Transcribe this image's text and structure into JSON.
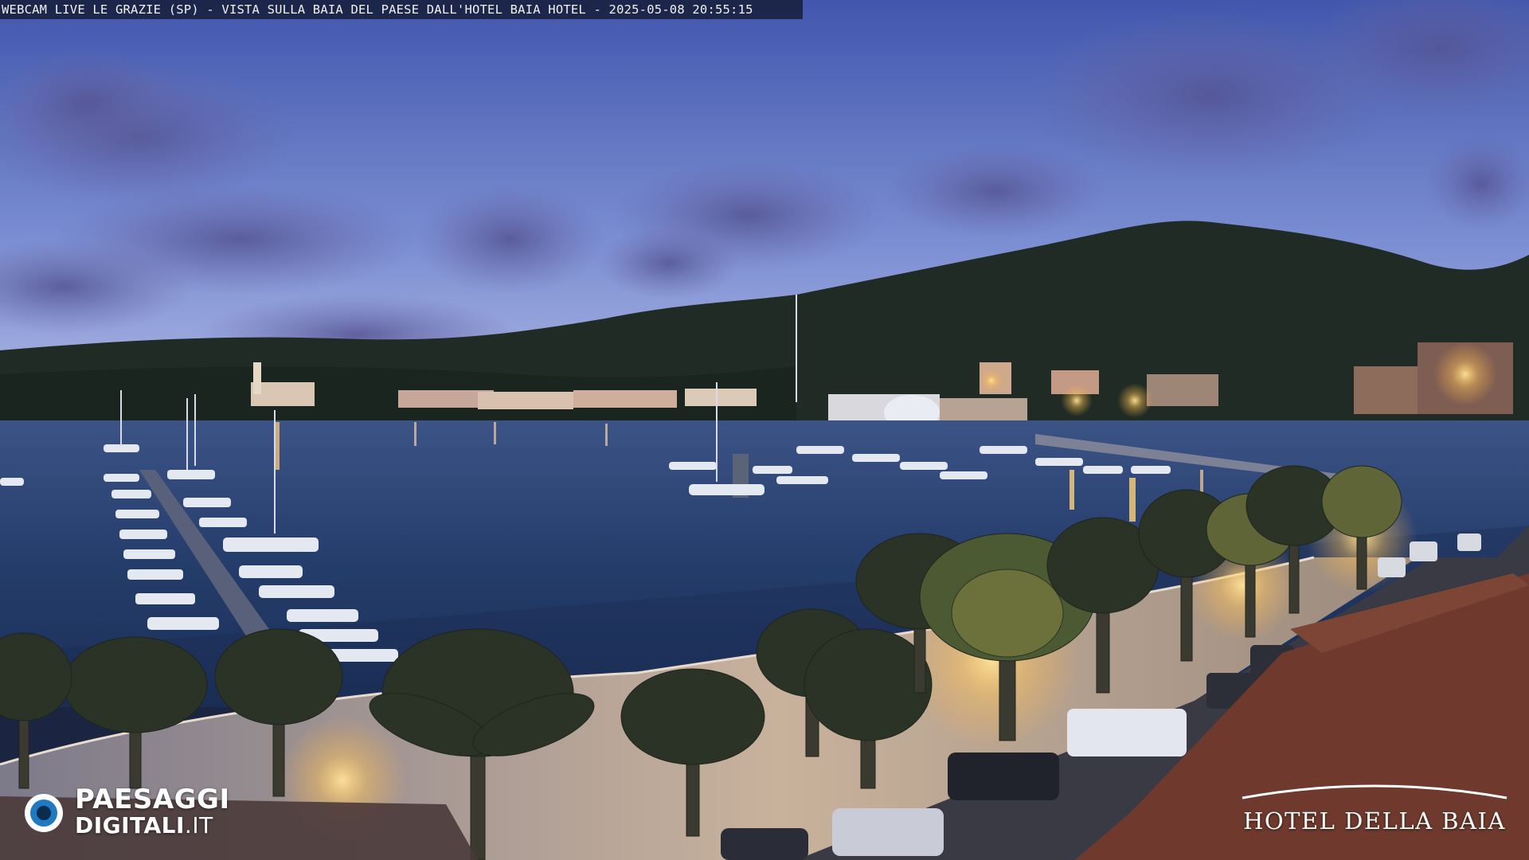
{
  "overlay": {
    "caption": "WEBCAM LIVE LE GRAZIE (SP) - VISTA SULLA BAIA DEL PAESE DALL'HOTEL BAIA HOTEL - 2025-05-08 20:55:15"
  },
  "watermark": {
    "brand_line1": "PAESAGGI",
    "brand_line2": "DIGITALI",
    "brand_tld": ".IT",
    "icon": "eye-camera-icon"
  },
  "hotel_logo": {
    "name": "HOTEL DELLA BAIA"
  },
  "scene": {
    "description_icons": [
      "sky",
      "clouds",
      "hillside",
      "bay-water",
      "marina-boats",
      "palm-trees",
      "promenade",
      "street-lamps",
      "parked-cars",
      "terracotta-roof"
    ],
    "colors": {
      "sky_top": "#4a63b8",
      "sky_bottom": "#a9b6e4",
      "cloud": "#5d5c9a",
      "hill": "#1e2a22",
      "water": "#233a66",
      "promenade": "#b8a79a",
      "lamp_glow": "#ffce6a",
      "roof": "#7a4334"
    }
  }
}
